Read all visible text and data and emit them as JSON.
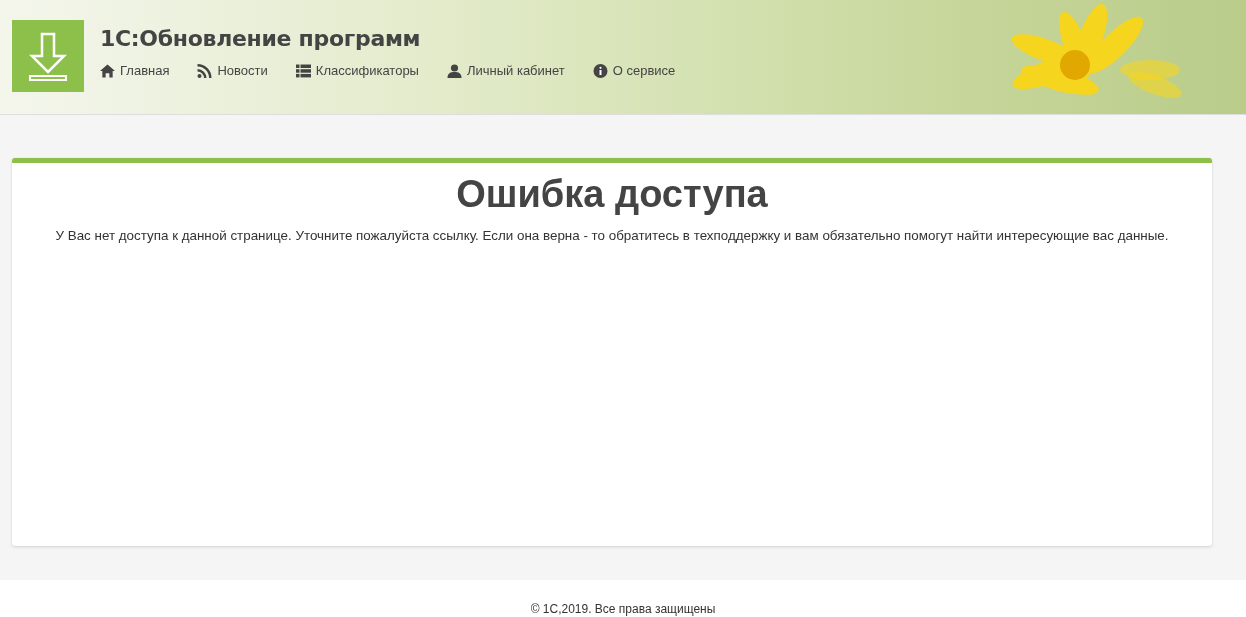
{
  "header": {
    "title": "1С:Обновление программ",
    "nav": [
      {
        "label": "Главная"
      },
      {
        "label": "Новости"
      },
      {
        "label": "Классификаторы"
      },
      {
        "label": "Личный кабинет"
      },
      {
        "label": "О сервисе"
      }
    ]
  },
  "content": {
    "heading": "Ошибка доступа",
    "message": "У Вас нет доступа к данной странице. Уточните пожалуйста ссылку. Если она верна - то обратитесь в техподдержку и вам обязательно помогут найти интересующие вас данные."
  },
  "footer": {
    "copyright": "© 1С,2019. Все права защищены"
  }
}
